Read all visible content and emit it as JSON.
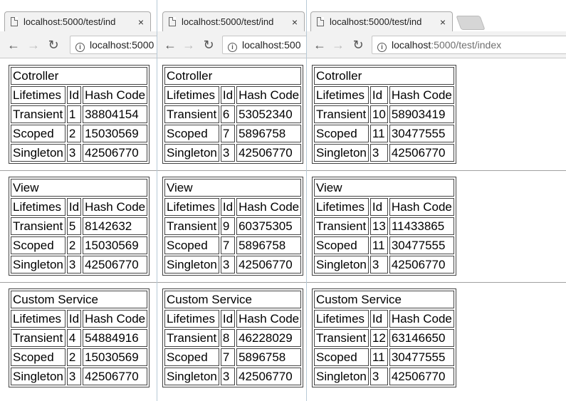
{
  "windows": [
    {
      "tab_title": "localhost:5000/test/ind",
      "url_host": "localhost:5000",
      "url_path": "",
      "sections": [
        {
          "title": "Cotroller",
          "headers": [
            "Lifetimes",
            "Id",
            "Hash Code"
          ],
          "rows": [
            [
              "Transient",
              "1",
              "38804154"
            ],
            [
              "Scoped",
              "2",
              "15030569"
            ],
            [
              "Singleton",
              "3",
              "42506770"
            ]
          ]
        },
        {
          "title": "View",
          "headers": [
            "Lifetimes",
            "Id",
            "Hash Code"
          ],
          "rows": [
            [
              "Transient",
              "5",
              "8142632"
            ],
            [
              "Scoped",
              "2",
              "15030569"
            ],
            [
              "Singleton",
              "3",
              "42506770"
            ]
          ]
        },
        {
          "title": "Custom Service",
          "headers": [
            "Lifetimes",
            "Id",
            "Hash Code"
          ],
          "rows": [
            [
              "Transient",
              "4",
              "54884916"
            ],
            [
              "Scoped",
              "2",
              "15030569"
            ],
            [
              "Singleton",
              "3",
              "42506770"
            ]
          ]
        }
      ]
    },
    {
      "tab_title": "localhost:5000/test/ind",
      "url_host": "localhost:500",
      "url_path": "",
      "sections": [
        {
          "title": "Cotroller",
          "headers": [
            "Lifetimes",
            "Id",
            "Hash Code"
          ],
          "rows": [
            [
              "Transient",
              "6",
              "53052340"
            ],
            [
              "Scoped",
              "7",
              "5896758"
            ],
            [
              "Singleton",
              "3",
              "42506770"
            ]
          ]
        },
        {
          "title": "View",
          "headers": [
            "Lifetimes",
            "Id",
            "Hash Code"
          ],
          "rows": [
            [
              "Transient",
              "9",
              "60375305"
            ],
            [
              "Scoped",
              "7",
              "5896758"
            ],
            [
              "Singleton",
              "3",
              "42506770"
            ]
          ]
        },
        {
          "title": "Custom Service",
          "headers": [
            "Lifetimes",
            "Id",
            "Hash Code"
          ],
          "rows": [
            [
              "Transient",
              "8",
              "46228029"
            ],
            [
              "Scoped",
              "7",
              "5896758"
            ],
            [
              "Singleton",
              "3",
              "42506770"
            ]
          ]
        }
      ]
    },
    {
      "tab_title": "localhost:5000/test/ind",
      "url_host": "localhost",
      "url_path": ":5000/test/index",
      "sections": [
        {
          "title": "Cotroller",
          "headers": [
            "Lifetimes",
            "Id",
            "Hash Code"
          ],
          "rows": [
            [
              "Transient",
              "10",
              "58903419"
            ],
            [
              "Scoped",
              "11",
              "30477555"
            ],
            [
              "Singleton",
              "3",
              "42506770"
            ]
          ]
        },
        {
          "title": "View",
          "headers": [
            "Lifetimes",
            "Id",
            "Hash Code"
          ],
          "rows": [
            [
              "Transient",
              "13",
              "11433865"
            ],
            [
              "Scoped",
              "11",
              "30477555"
            ],
            [
              "Singleton",
              "3",
              "42506770"
            ]
          ]
        },
        {
          "title": "Custom Service",
          "headers": [
            "Lifetimes",
            "Id",
            "Hash Code"
          ],
          "rows": [
            [
              "Transient",
              "12",
              "63146650"
            ],
            [
              "Scoped",
              "11",
              "30477555"
            ],
            [
              "Singleton",
              "3",
              "42506770"
            ]
          ]
        }
      ]
    }
  ],
  "icons": {
    "back": "←",
    "forward": "→",
    "reload": "↻",
    "close": "×",
    "info": "i"
  },
  "colors": {
    "tab_bg": "#f2f2f2",
    "toolbar_bg": "#f2f2f2",
    "window_divider": "#b7c9d6",
    "table_border": "#444444"
  }
}
